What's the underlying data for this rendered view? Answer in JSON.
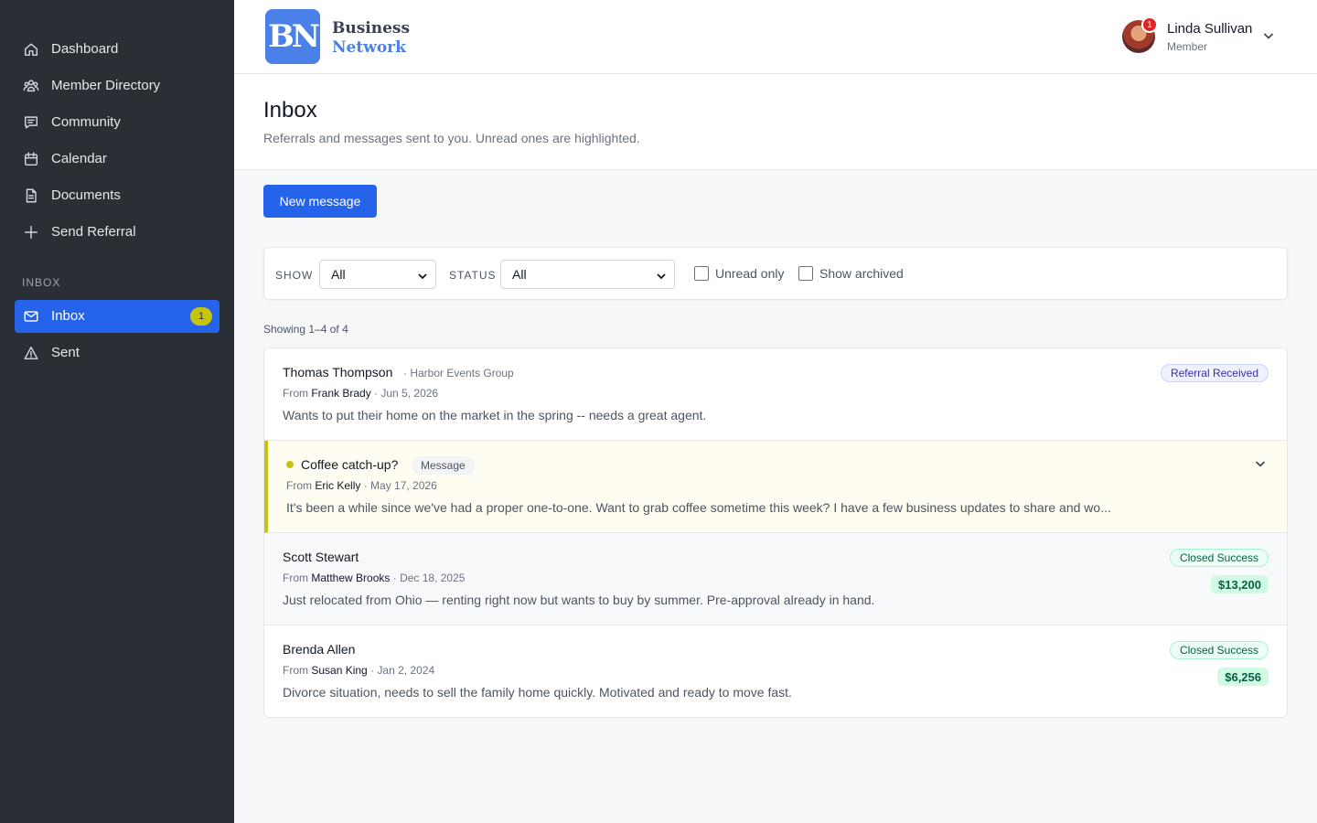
{
  "sidebar": {
    "items": [
      {
        "label": "Dashboard",
        "icon": "home-icon"
      },
      {
        "label": "Member Directory",
        "icon": "users-icon"
      },
      {
        "label": "Community",
        "icon": "chat-icon"
      },
      {
        "label": "Calendar",
        "icon": "calendar-icon"
      },
      {
        "label": "Documents",
        "icon": "document-icon"
      },
      {
        "label": "Send Referral",
        "icon": "plus-icon"
      }
    ],
    "section_label": "INBOX",
    "inbox_items": [
      {
        "label": "Inbox",
        "icon": "mail-icon",
        "badge": "1",
        "active": true
      },
      {
        "label": "Sent",
        "icon": "sent-icon"
      }
    ],
    "active_color": "#2563eb",
    "badge_color": "#c6c40f"
  },
  "header": {
    "logo_mark": "BN",
    "logo_line1": "Business",
    "logo_line2": "Network",
    "user": {
      "name": "Linda Sullivan",
      "role": "Member",
      "notification_count": "1"
    }
  },
  "page": {
    "title": "Inbox",
    "subtitle": "Referrals and messages sent to you. Unread ones are highlighted.",
    "new_button": "New message"
  },
  "filters": {
    "show_label": "SHOW",
    "show_value": "All",
    "status_label": "STATUS",
    "status_value": "All",
    "unread_only": {
      "label": "Unread only",
      "checked": false
    },
    "show_archived": {
      "label": "Show archived",
      "checked": false
    }
  },
  "showing": "Showing 1–4 of 4",
  "messages": [
    {
      "name": "Thomas Thompson",
      "org": "· Harbor Events Group",
      "from_prefix": "From",
      "from": "Frank Brady",
      "date": "· Jun 5, 2026",
      "body": "Wants to put their home on the market in the spring -- needs a great agent.",
      "status": "Referral Received"
    },
    {
      "name": "Coffee catch-up?",
      "tag": "Message",
      "from_prefix": "From",
      "from": "Eric Kelly",
      "date": "· May 17, 2026",
      "body": "It's been a while since we've had a proper one-to-one. Want to grab coffee sometime this week? I have a few business updates to share and wo...",
      "unread": true
    },
    {
      "name": "Scott Stewart",
      "from_prefix": "From",
      "from": "Matthew Brooks",
      "date": "· Dec 18, 2025",
      "body": "Just relocated from Ohio — renting right now but wants to buy by summer. Pre-approval already in hand.",
      "status": "Closed Success",
      "amount": "$13,200"
    },
    {
      "name": "Brenda Allen",
      "from_prefix": "From",
      "from": "Susan King",
      "date": "· Jan 2, 2024",
      "body": "Divorce situation, needs to sell the family home quickly. Motivated and ready to move fast.",
      "status": "Closed Success",
      "amount": "$6,256"
    }
  ]
}
